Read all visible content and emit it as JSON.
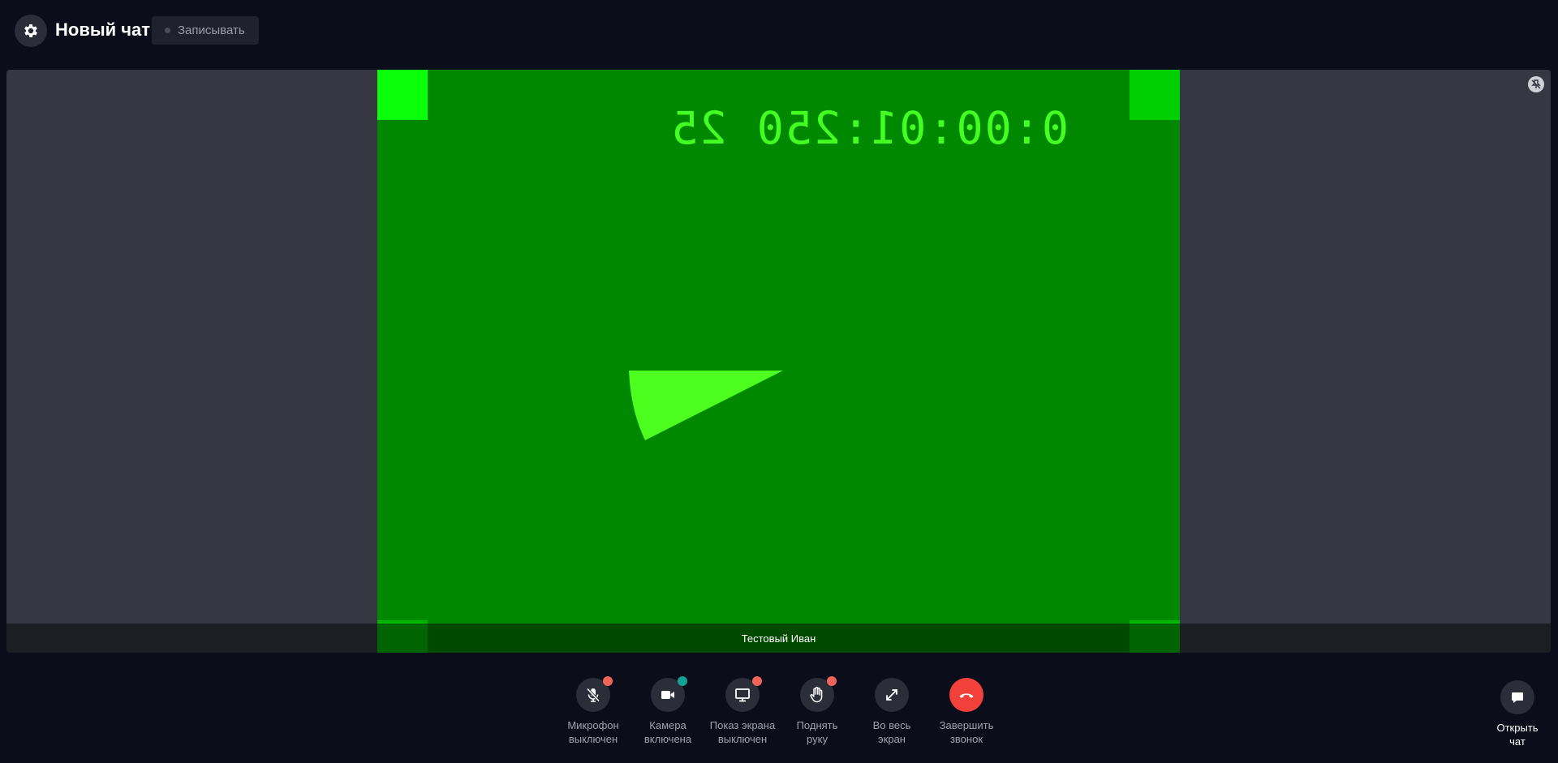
{
  "header": {
    "title": "Новый чат",
    "record_label": "Записывать"
  },
  "video": {
    "timecode": "0:00:01:250 25",
    "participant_name": "Тестовый Иван"
  },
  "controls": [
    {
      "label_line1": "Микрофон",
      "label_line2": "выключен",
      "icon": "mic-off-icon",
      "status": "off"
    },
    {
      "label_line1": "Камера",
      "label_line2": "включена",
      "icon": "camera-icon",
      "status": "on"
    },
    {
      "label_line1": "Показ экрана",
      "label_line2": "выключен",
      "icon": "monitor-icon",
      "status": "off"
    },
    {
      "label_line1": "Поднять",
      "label_line2": "руку",
      "icon": "hand-icon",
      "status": "off"
    },
    {
      "label_line1": "Во весь",
      "label_line2": "экран",
      "icon": "expand-icon"
    },
    {
      "label_line1": "Завершить",
      "label_line2": "звонок",
      "icon": "hangup-icon"
    }
  ],
  "chat_button": {
    "label_line1": "Открыть",
    "label_line2": "чат",
    "icon": "chat-bubble-icon"
  },
  "colors": {
    "background": "#0b0e1a",
    "stage": "#363743",
    "video_green": "#008800",
    "accent_green": "#44ff22",
    "status_red": "#f0645a",
    "status_teal": "#12a293",
    "end_call_red": "#f1413a"
  }
}
